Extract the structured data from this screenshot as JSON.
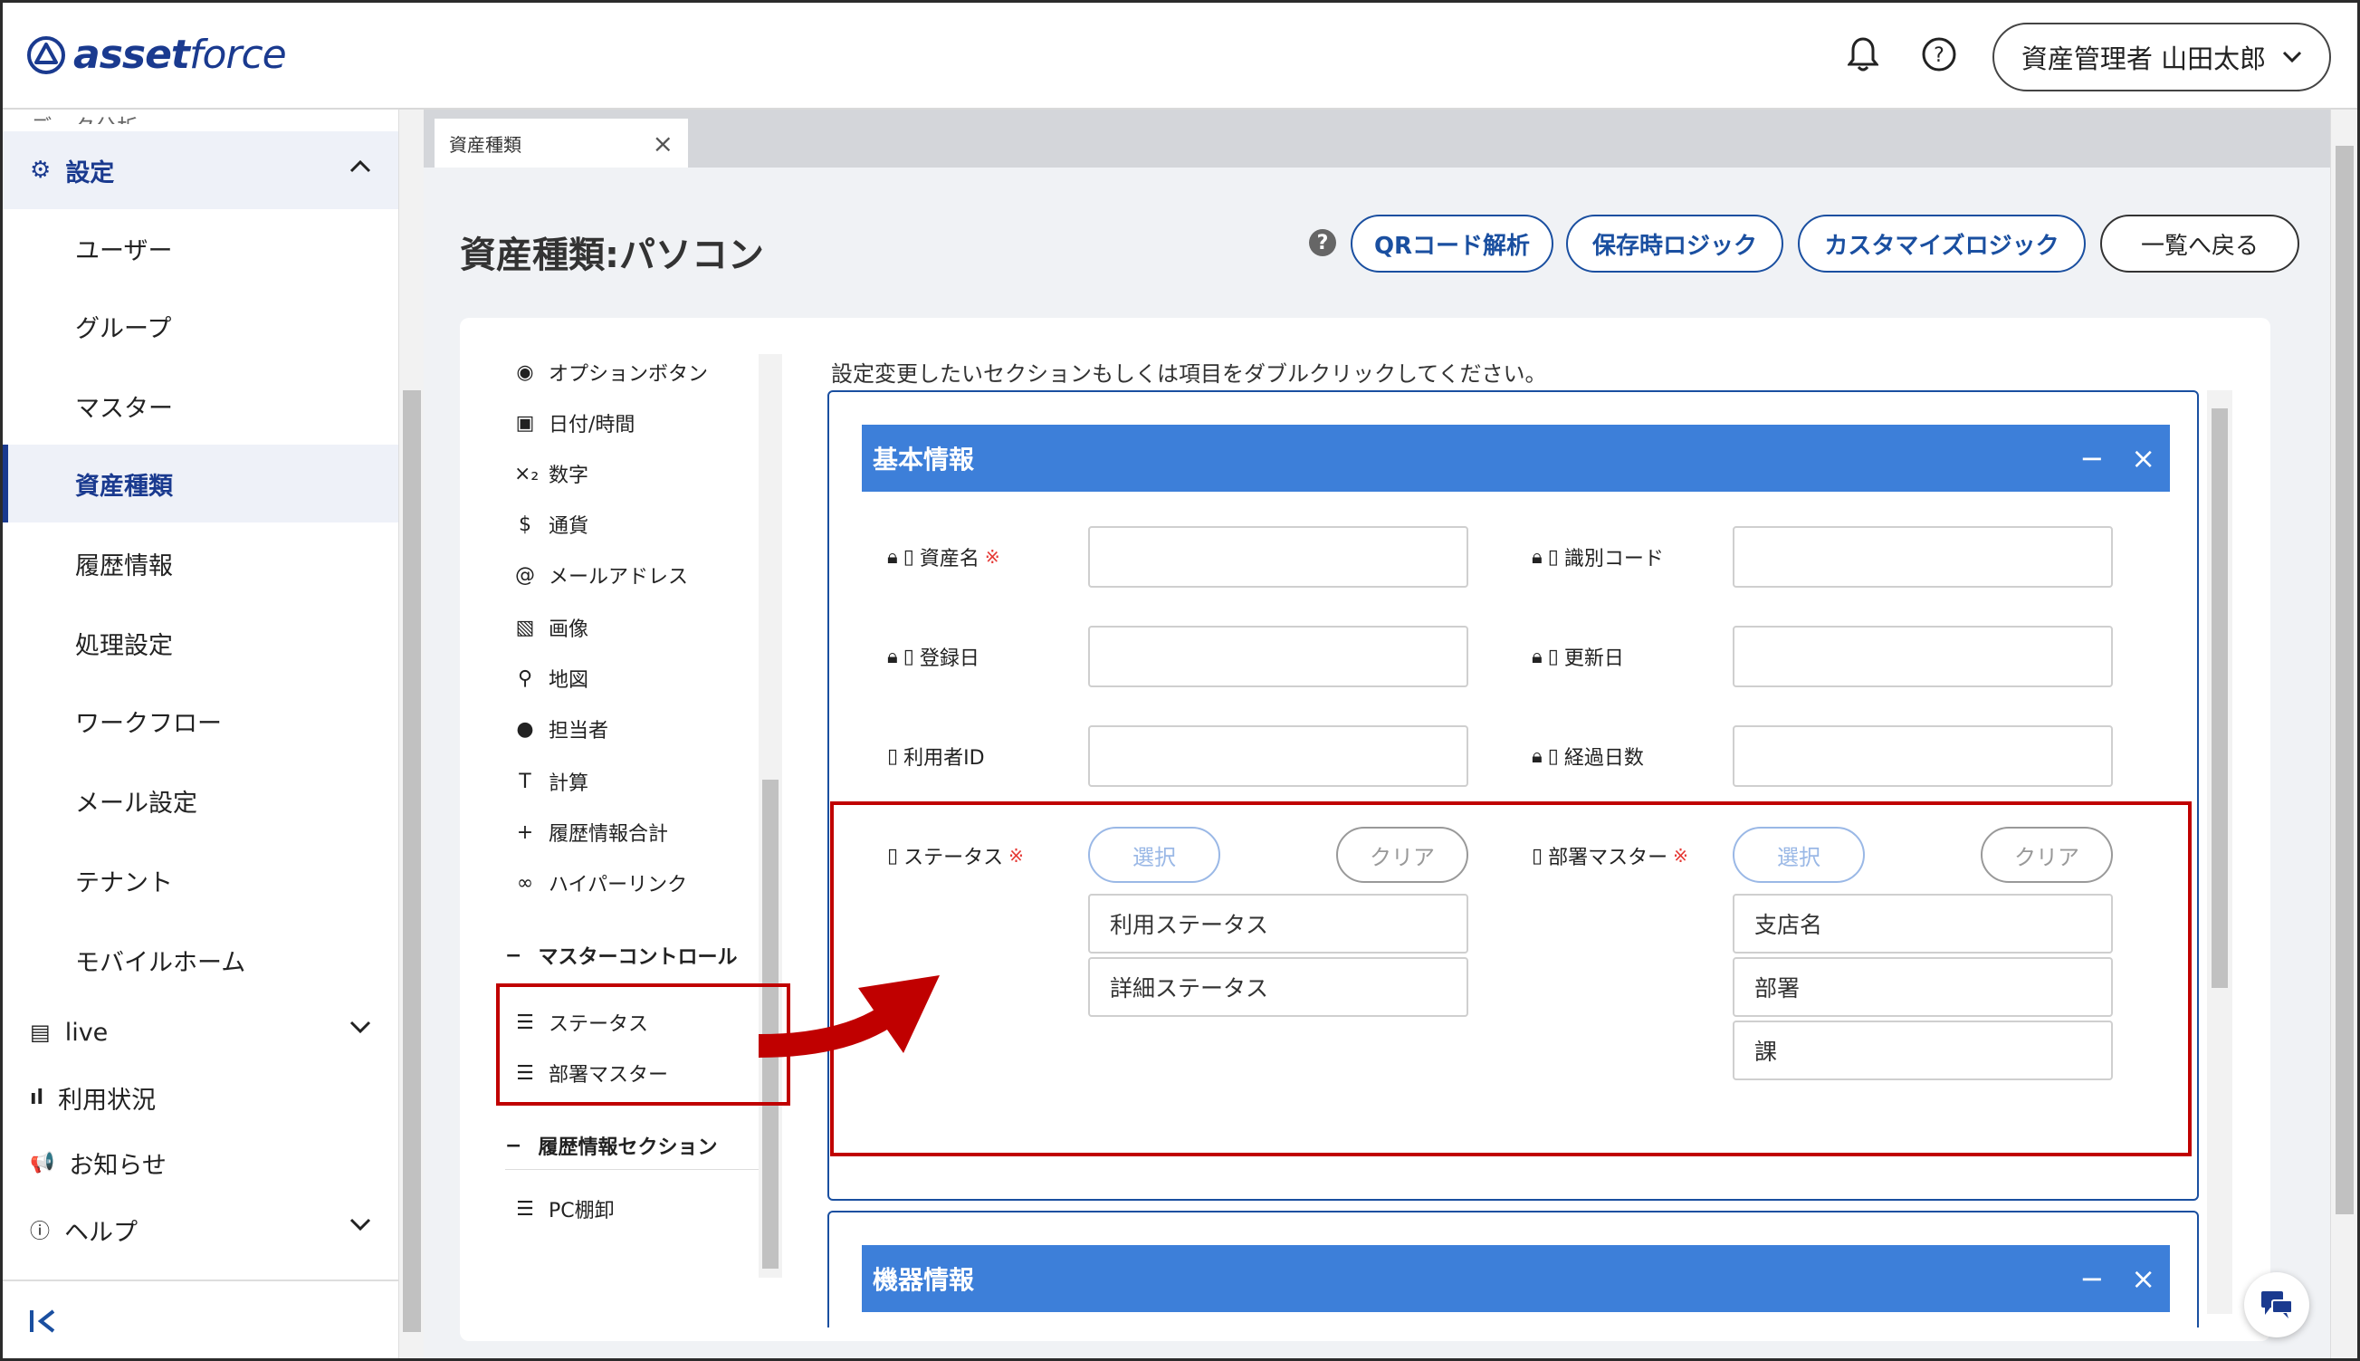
{
  "header": {
    "logo_bold": "asset",
    "logo_light": "force",
    "user_label": "資産管理者 山田太郎"
  },
  "sidebar": {
    "cut_item": "データ分析",
    "settings_label": "設定",
    "sub_items": [
      {
        "label": "ユーザー"
      },
      {
        "label": "グループ"
      },
      {
        "label": "マスター"
      },
      {
        "label": "資産種類"
      },
      {
        "label": "履歴情報"
      },
      {
        "label": "処理設定"
      },
      {
        "label": "ワークフロー"
      },
      {
        "label": "メール設定"
      },
      {
        "label": "テナント"
      },
      {
        "label": "モバイルホーム"
      }
    ],
    "live_label": "live",
    "usage_label": "利用状況",
    "news_label": "お知らせ",
    "help_label": "ヘルプ"
  },
  "tab": {
    "label": "資産種類"
  },
  "page": {
    "title": "資産種類:パソコン",
    "btn_qr": "QRコード解析",
    "btn_save_logic": "保存時ロジック",
    "btn_custom_logic": "カスタマイズロジック",
    "btn_back": "一覧へ戻る"
  },
  "palette": {
    "items": [
      {
        "icon": "◉",
        "label": "オプションボタン"
      },
      {
        "icon": "▣",
        "label": "日付/時間"
      },
      {
        "icon": "×₂",
        "label": "数字"
      },
      {
        "icon": "$",
        "label": "通貨"
      },
      {
        "icon": "@",
        "label": "メールアドレス"
      },
      {
        "icon": "▧",
        "label": "画像"
      },
      {
        "icon": "⚲",
        "label": "地図"
      },
      {
        "icon": "●",
        "label": "担当者"
      },
      {
        "icon": "T",
        "label": "計算"
      },
      {
        "icon": "+",
        "label": "履歴情報合計"
      },
      {
        "icon": "∞",
        "label": "ハイパーリンク"
      }
    ],
    "master_header": "マスターコントロール",
    "master_items": [
      {
        "icon": "☰",
        "label": "ステータス"
      },
      {
        "icon": "☰",
        "label": "部署マスター"
      }
    ],
    "history_header": "履歴情報セクション",
    "history_items": [
      {
        "icon": "☰",
        "label": "PC棚卸"
      }
    ]
  },
  "canvas": {
    "hint": "設定変更したいセクションもしくは項目をダブルクリックしてください。",
    "section1": {
      "title": "基本情報",
      "fields": [
        {
          "label": "資産名",
          "required": "※"
        },
        {
          "label": "識別コード",
          "required": ""
        },
        {
          "label": "登録日",
          "required": ""
        },
        {
          "label": "更新日",
          "required": ""
        },
        {
          "label": "利用者ID",
          "required": ""
        },
        {
          "label": "経過日数",
          "required": ""
        }
      ],
      "status": {
        "label": "ステータス",
        "required": "※",
        "select": "選択",
        "clear": "クリア",
        "values": [
          "利用ステータス",
          "詳細ステータス"
        ]
      },
      "dept": {
        "label": "部署マスター",
        "required": "※",
        "select": "選択",
        "clear": "クリア",
        "values": [
          "支店名",
          "部署",
          "課"
        ]
      }
    },
    "section2": {
      "title": "機器情報"
    }
  },
  "colors": {
    "brand": "#1a3a8f",
    "section_header": "#3d7fd9",
    "highlight": "#c00000",
    "required": "#e53935"
  }
}
